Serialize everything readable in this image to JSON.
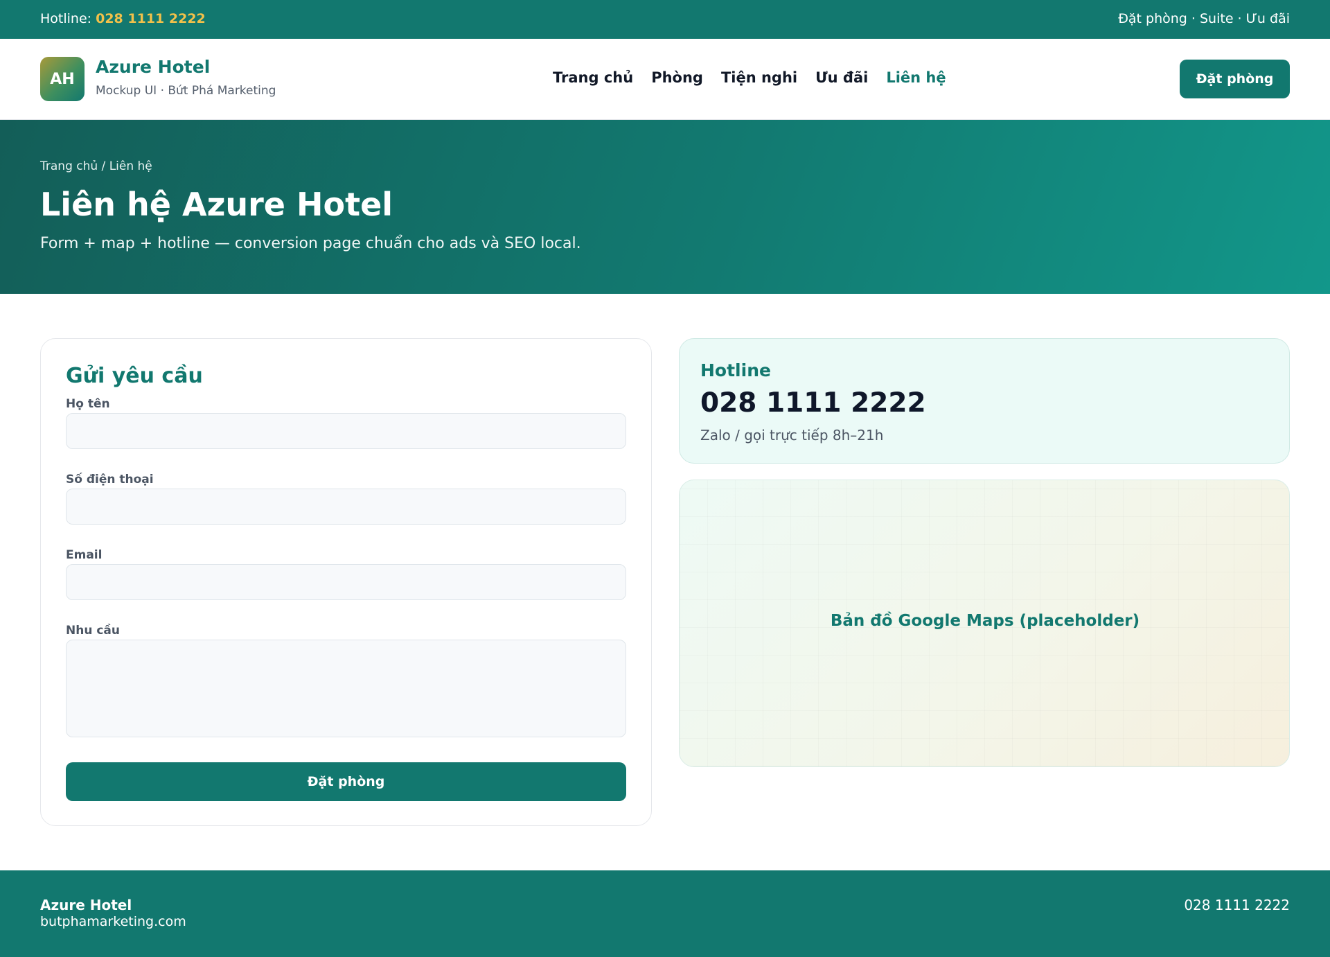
{
  "topbar": {
    "hotline_label": "Hotline:",
    "hotline_number": "028 1111 2222",
    "right_links": "Đặt phòng · Suite · Ưu đãi"
  },
  "header": {
    "logo_text": "AH",
    "brand_name": "Azure Hotel",
    "brand_sub": "Mockup UI · Bứt Phá Marketing",
    "nav": [
      "Trang chủ",
      "Phòng",
      "Tiện nghi",
      "Ưu đãi",
      "Liên hệ"
    ],
    "active_nav": "Liên hệ",
    "cta": "Đặt phòng"
  },
  "hero": {
    "breadcrumb": "Trang chủ / Liên hệ",
    "title": "Liên hệ Azure Hotel",
    "subtitle": "Form + map + hotline — conversion page chuẩn cho ads và SEO local."
  },
  "form": {
    "title": "Gửi yêu cầu",
    "name_label": "Họ tên",
    "name_value": "",
    "phone_label": "Số điện thoại",
    "phone_value": "",
    "email_label": "Email",
    "email_value": "",
    "need_label": "Nhu cầu",
    "need_value": "",
    "submit": "Đặt phòng"
  },
  "hotline_card": {
    "label": "Hotline",
    "number": "028 1111 2222",
    "note": "Zalo / gọi trực tiếp 8h–21h"
  },
  "map": {
    "placeholder": "Bản đồ Google Maps (placeholder)"
  },
  "footer": {
    "name": "Azure Hotel",
    "site": "butphamarketing.com",
    "phone": "028 1111 2222"
  },
  "colors": {
    "brand": "#12786f",
    "accent": "#f2c14a",
    "hotline_bg": "#ebfaf7"
  }
}
